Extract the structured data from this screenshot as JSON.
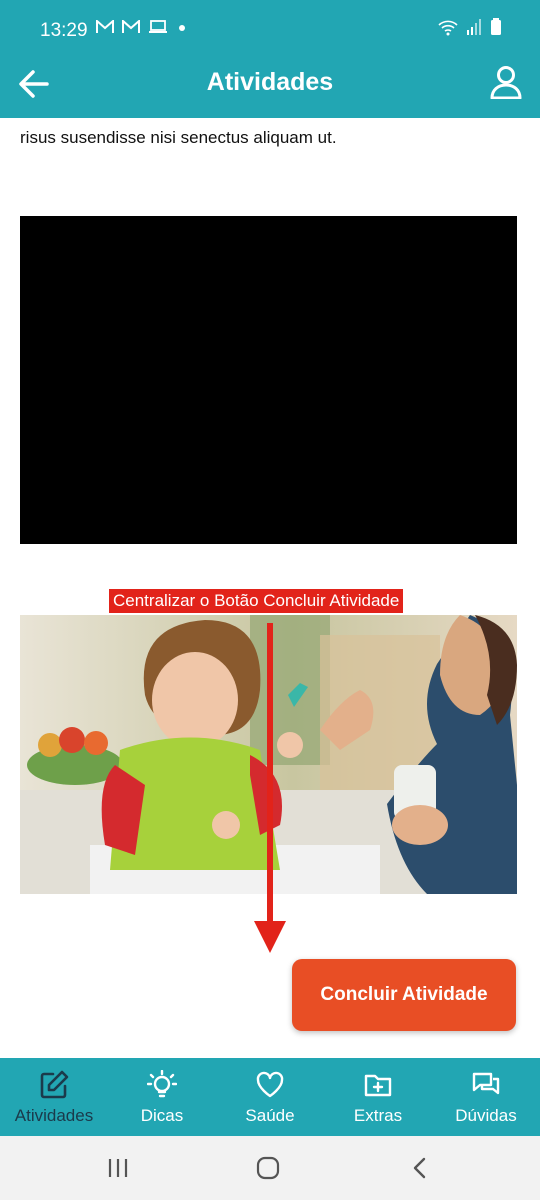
{
  "status_bar": {
    "time": "13:29",
    "icons_left": [
      "gmail-icon",
      "gmail-icon",
      "laptop-icon",
      "dot-icon"
    ],
    "icons_right": [
      "wifi-icon",
      "signal-icon",
      "battery-icon"
    ]
  },
  "app_bar": {
    "title": "Atividades",
    "back_icon": "arrow-left-icon",
    "profile_icon": "user-icon"
  },
  "content": {
    "paragraph": "risus susendisse nisi senectus aliquam ut.",
    "video_placeholder": "video-player",
    "annotation": "Centralizar o Botão Concluir Atividade",
    "complete_button": "Concluir Atividade"
  },
  "bottom_nav": {
    "items": [
      {
        "label": "Atividades",
        "icon": "edit-icon",
        "active": true
      },
      {
        "label": "Dicas",
        "icon": "lightbulb-icon",
        "active": false
      },
      {
        "label": "Saúde",
        "icon": "heart-icon",
        "active": false
      },
      {
        "label": "Extras",
        "icon": "folder-plus-icon",
        "active": false
      },
      {
        "label": "Dúvidas",
        "icon": "chat-icon",
        "active": false
      }
    ]
  },
  "colors": {
    "primary": "#22a6b3",
    "accent_button": "#e84e25",
    "annotation": "#e2231a",
    "active_nav": "#1b3a4b"
  }
}
